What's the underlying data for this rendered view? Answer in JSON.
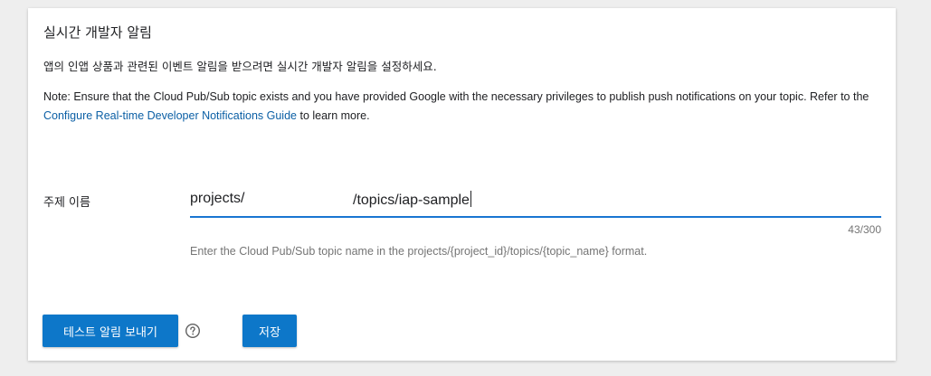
{
  "section": {
    "title": "실시간 개발자 알림",
    "description": "앱의 인앱 상품과 관련된 이벤트 알림을 받으려면 실시간 개발자 알림을 설정하세요.",
    "note_prefix": "Note: Ensure that the Cloud Pub/Sub topic exists and you have provided Google with the necessary privileges to publish push notifications on your topic. Refer to the ",
    "note_link": "Configure Real-time Developer Notifications Guide",
    "note_suffix": " to learn more."
  },
  "topic_field": {
    "label": "주제 이름",
    "value_prefix": "projects/",
    "value_suffix": "/topics/iap-sample",
    "counter": "43/300",
    "hint": "Enter the Cloud Pub/Sub topic name in the projects/{project_id}/topics/{topic_name} format."
  },
  "actions": {
    "test_label": "테스트 알림 보내기",
    "save_label": "저장"
  },
  "icons": {
    "help": "help-circle-icon"
  },
  "colors": {
    "accent": "#0d77c9",
    "link": "#0b5fa5",
    "input_underline": "#1976d2"
  }
}
